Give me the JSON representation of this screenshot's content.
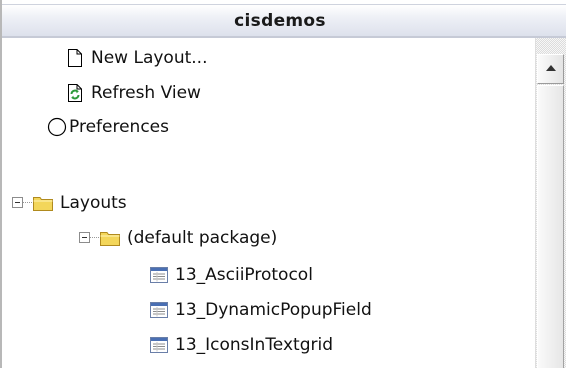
{
  "panel": {
    "title": "cisdemos"
  },
  "tree": {
    "actions": [
      {
        "label": "New Layout...",
        "icon": "new-document-icon"
      },
      {
        "label": "Refresh View",
        "icon": "refresh-icon"
      },
      {
        "label": "Preferences",
        "icon": "preferences-circle-icon"
      }
    ],
    "layouts": {
      "label": "Layouts",
      "icon": "folder-icon",
      "expanded": true,
      "default_package": {
        "label": "(default package)",
        "icon": "folder-icon",
        "expanded": true,
        "items": [
          {
            "label": "13_AsciiProtocol",
            "icon": "layout-file-icon"
          },
          {
            "label": "13_DynamicPopupField",
            "icon": "layout-file-icon"
          },
          {
            "label": "13_IconsInTextgrid",
            "icon": "layout-file-icon"
          }
        ]
      }
    }
  },
  "colors": {
    "folder": "#f3d65a",
    "refresh": "#2e9a3a",
    "layout_file_header": "#4a6fb3"
  }
}
